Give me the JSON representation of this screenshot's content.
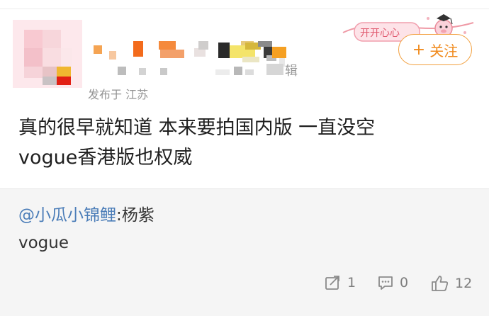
{
  "post": {
    "location": "发布于 江苏",
    "text_line1": "真的很早就知道 本来要拍国内版 一直没空",
    "text_line2": "vogue香港版也权威"
  },
  "header": {
    "follow_label": "关注",
    "follow_plus": "+",
    "sticker_text": "开开心心",
    "sub_suffix": "辑"
  },
  "repost": {
    "mention": "@小瓜小锦鲤",
    "author_sep": ":",
    "author_name": "杨紫",
    "body": "vogue"
  },
  "actions": {
    "share_count": "1",
    "comment_count": "0",
    "like_count": "12"
  },
  "colors": {
    "follow": "#f08a1c",
    "mention": "#4b7db8",
    "repost_bg": "#f5f5f5"
  },
  "icons": [
    "share-icon",
    "comment-icon",
    "like-icon",
    "plus-icon"
  ]
}
